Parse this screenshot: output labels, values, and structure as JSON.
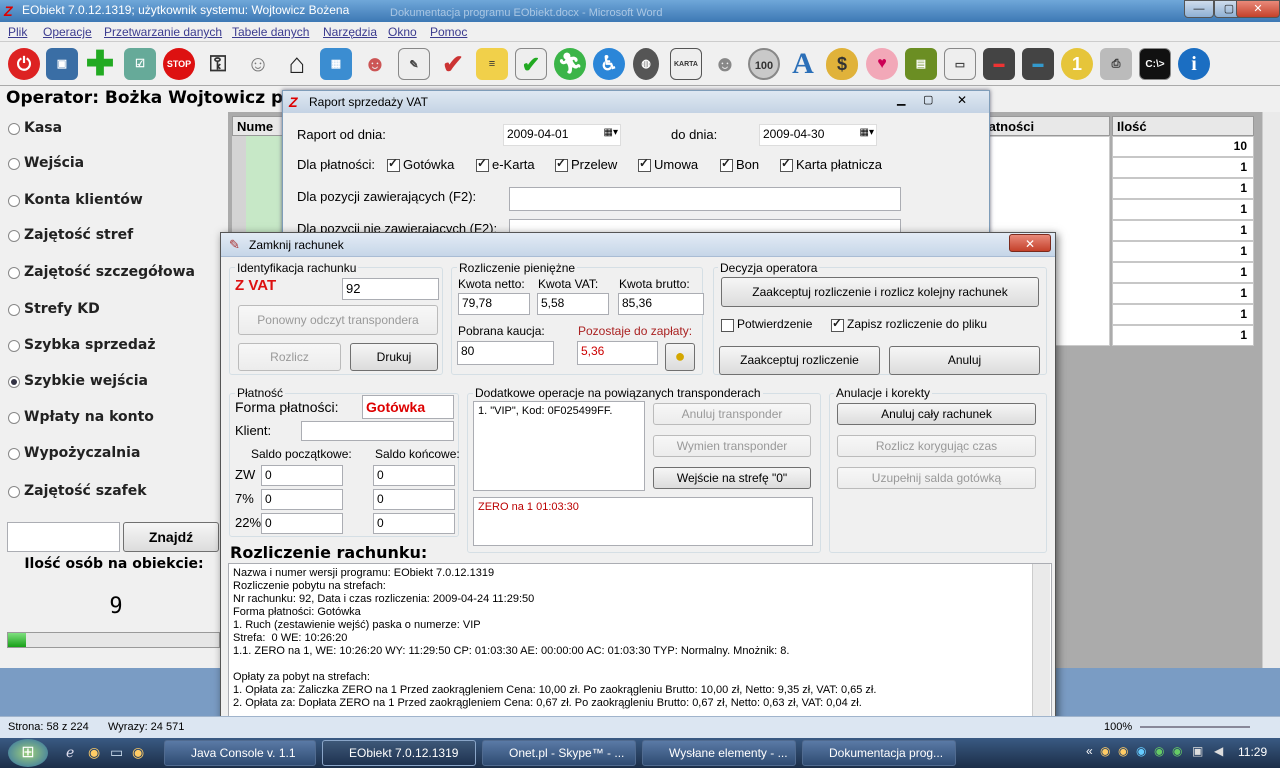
{
  "app": {
    "title": "EObiekt 7.0.12.1319; użytkownik systemu: Wojtowicz Bożena",
    "bg_title": "Dokumentacja programu EObiekt.docx - Microsoft Word"
  },
  "menu": [
    "Plik",
    "Operacje",
    "Przetwarzanie danych",
    "Tabele danych",
    "Narzędzia",
    "Okno",
    "Pomoc"
  ],
  "toolbar_icons": [
    "power-icon",
    "windows-icon",
    "add-icon",
    "checklist-icon",
    "stop-icon",
    "key-icon",
    "user-icon",
    "home-icon",
    "map-icon",
    "users-icon",
    "document-icon",
    "edit-check-icon",
    "notes-icon",
    "tick-icon",
    "run-icon",
    "accessibility-icon",
    "wristband-icon",
    "card-icon",
    "users2-icon",
    "coin-icon",
    "font-icon",
    "money-bag-icon",
    "piggy-icon",
    "clipboard-icon",
    "folder-icon",
    "scanner-icon",
    "scanner2-icon",
    "coin2-icon",
    "printer-icon",
    "console-icon",
    "info-icon"
  ],
  "toolbar_labels": {
    "stop": "STOP",
    "coin": "100",
    "font": "A",
    "console": "C:\\>",
    "info": "i",
    "money": "$",
    "gold": "1",
    "card": "KARTA"
  },
  "operator": "Operator: Bożka Wojtowicz przyp",
  "left_menu": {
    "items": [
      "Kasa",
      "Wejścia",
      "Konta klientów",
      "Zajętość stref",
      "Zajętość szczegółowa",
      "Strefy KD",
      "Szybka sprzedaż",
      "Szybkie wejścia",
      "Wpłaty na konto",
      "Wypożyczalnia",
      "Zajętość szafek"
    ],
    "selected_index": 7,
    "find_button": "Znajdź",
    "count_label": "Ilość osób na obiekcie:",
    "count_value": "9"
  },
  "grid": {
    "headers": {
      "first": "Nume",
      "payment": "łatności",
      "qty": "Ilość"
    },
    "qty_values": [
      "10",
      "1",
      "1",
      "1",
      "1",
      "1",
      "1",
      "1",
      "1",
      "1"
    ]
  },
  "report": {
    "title": "Raport sprzedaży VAT",
    "from_label": "Raport od dnia:",
    "from_value": "2009-04-01",
    "to_label": "do dnia:",
    "to_value": "2009-04-30",
    "payments_label": "Dla płatności:",
    "payments": [
      "Gotówka",
      "e-Karta",
      "Przelew",
      "Umowa",
      "Bon",
      "Karta płatnicza"
    ],
    "incl_label": "Dla pozycji zawierających (F2):",
    "excl_label": "Dla pozycji nie zawierających (F2):"
  },
  "dialog": {
    "title": "Zamknij rachunek",
    "ident": {
      "group": "Identyfikacja rachunku",
      "type": "Z VAT",
      "number": "92",
      "reread": "Ponowny odczyt transpondera",
      "settle": "Rozlicz",
      "print": "Drukuj"
    },
    "money": {
      "group": "Rozliczenie pieniężne",
      "net_label": "Kwota netto:",
      "net": "79,78",
      "vat_label": "Kwota VAT:",
      "vat": "5,58",
      "gross_label": "Kwota brutto:",
      "gross": "85,36",
      "deposit_label": "Pobrana kaucja:",
      "deposit": "80",
      "remain_label": "Pozostaje do zapłaty:",
      "remain": "5,36"
    },
    "decision": {
      "group": "Decyzja operatora",
      "accept_next": "Zaakceptuj rozliczenie i rozlicz kolejny rachunek",
      "confirm": "Potwierdzenie",
      "save": "Zapisz rozliczenie do pliku",
      "accept": "Zaakceptuj rozliczenie",
      "cancel": "Anuluj"
    },
    "payment": {
      "group": "Płatność",
      "form_label": "Forma płatności:",
      "form": "Gotówka",
      "client_label": "Klient:",
      "client": "",
      "start_label": "Saldo początkowe:",
      "end_label": "Saldo końcowe:",
      "rows": [
        {
          "label": "ZW",
          "start": "0",
          "end": "0"
        },
        {
          "label": "7%",
          "start": "0",
          "end": "0"
        },
        {
          "label": "22%",
          "start": "0",
          "end": "0"
        }
      ]
    },
    "extra": {
      "group": "Dodatkowe operacje na powiązanych transponderach",
      "list": "1. \"VIP\", Kod: 0F025499FF.",
      "cancel_t": "Anuluj transponder",
      "swap_t": "Wymien transponder",
      "enter_zone": "Wejście na strefę \"0\"",
      "log": "ZERO na 1 01:03:30"
    },
    "corrections": {
      "group": "Anulacje i korekty",
      "cancel_all": "Anuluj cały rachunek",
      "settle_time": "Rozlicz korygując czas",
      "fill_cash": "Uzupełnij salda gotówką"
    },
    "summary_title": "Rozliczenie rachunku:",
    "summary": "Nazwa i numer wersji programu: EObiekt 7.0.12.1319\nRozliczenie pobytu na strefach:\nNr rachunku: 92, Data i czas rozliczenia: 2009-04-24 11:29:50\nForma płatności: Gotówka\n1. Ruch (zestawienie wejść) paska o numerze: VIP\nStrefa:  0 WE: 10:26:20\n1.1. ZERO na 1, WE: 10:26:20 WY: 11:29:50 CP: 01:03:30 AE: 00:00:00 AC: 01:03:30 TYP: Normalny. Mnożnik: 8.\n\nOpłaty za pobyt na strefach:\n1. Opłata za: Zaliczka ZERO na 1 Przed zaokrągleniem Cena: 10,00 zł. Po zaokrągleniu Brutto: 10,00 zł, Netto: 9,35 zł, VAT: 0,65 zł.\n2. Opłata za: Dopłata ZERO na 1 Przed zaokrągleniem Cena: 0,67 zł. Po zaokrągleniu Brutto: 0,67 zł, Netto: 0,63 zł, VAT: 0,04 zł."
  },
  "status": {
    "page": "Strona: 58 z 224",
    "words": "Wyrazy: 24 571",
    "zoom": "100%"
  },
  "taskbar": {
    "tasks": [
      "Java Console v. 1.1",
      "EObiekt 7.0.12.1319",
      "Onet.pl - Skype™ - ...",
      "Wysłane elementy - ...",
      "Dokumentacja prog..."
    ],
    "clock": "11:29"
  }
}
